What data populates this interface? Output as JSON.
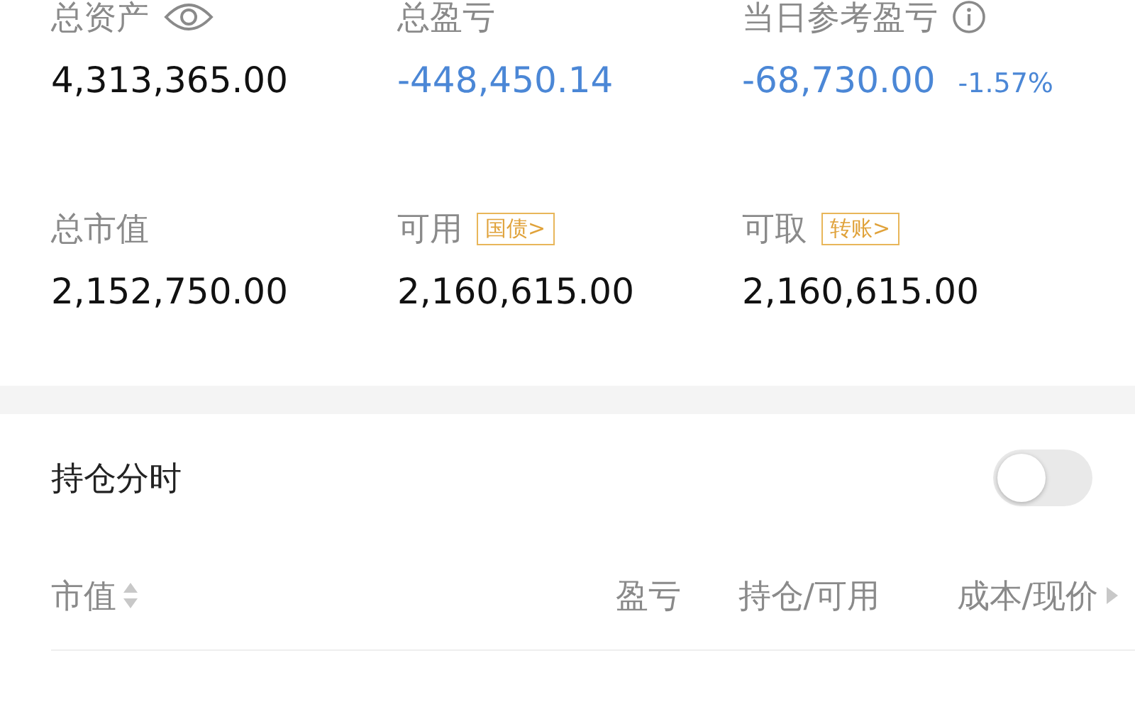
{
  "summary": [
    {
      "kind": "eye",
      "label": "总资产",
      "value": "4,313,365.00",
      "color": "#111111"
    },
    {
      "kind": "plain",
      "label": "总盈亏",
      "value": "-448,450.14",
      "color": "#4b87d6"
    },
    {
      "kind": "info",
      "label": "当日参考盈亏",
      "value": "-68,730.00",
      "extra": "-1.57%",
      "color": "#4b87d6"
    },
    {
      "kind": "plain",
      "label": "总市值",
      "value": "2,152,750.00",
      "color": "#111111"
    },
    {
      "kind": "badge",
      "label": "可用",
      "badge": "国债>",
      "value": "2,160,615.00",
      "color": "#111111"
    },
    {
      "kind": "badge",
      "label": "可取",
      "badge": "转账>",
      "value": "2,160,615.00",
      "color": "#111111"
    }
  ],
  "intraday": {
    "label": "持仓分时",
    "on": false
  },
  "columns": [
    {
      "kind": "sortable",
      "label": "市值"
    },
    {
      "kind": "plain",
      "label": "盈亏"
    },
    {
      "kind": "plain",
      "label": "持仓/可用"
    },
    {
      "kind": "more",
      "label": "成本/现价"
    }
  ]
}
